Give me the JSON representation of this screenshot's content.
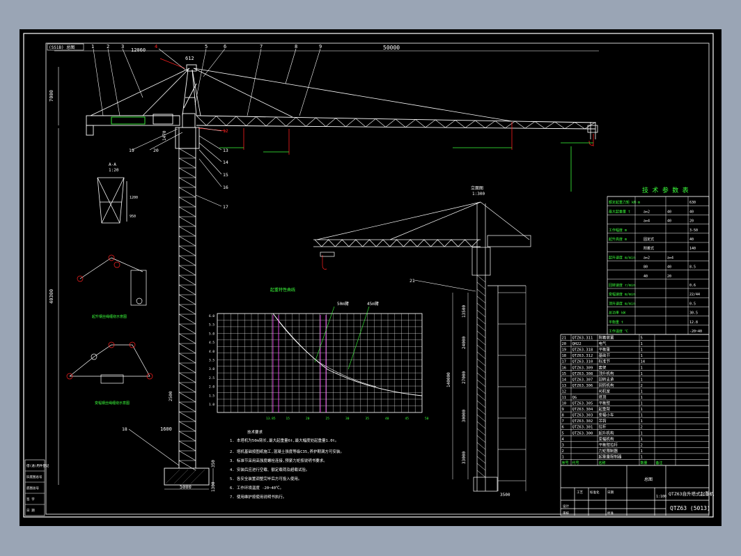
{
  "drawing": {
    "title_code": "QTZ63 (5013)",
    "title_name": "QTZ63自升塔式起重机",
    "scale_label": "1:100",
    "sheet_label": "总图",
    "top_tab": "(SS1B) 总图",
    "colors": {
      "background": "#000000",
      "line": "#ffffff",
      "green": "#3cff3c",
      "red": "#ff2020",
      "magenta": "#ff40ff",
      "yellow": "#ffff40"
    }
  },
  "dims": {
    "jib_length": "50000",
    "top_height": "7000",
    "counter_jib": "12060",
    "small_a": "612",
    "tower_height": "40300",
    "foundation_width": "5000",
    "foundation_h1": "1300",
    "foundation_h2": "350",
    "section_2500": "2500",
    "section_1600": "1600",
    "cab_1470": "1470",
    "right_dim_13500": "13500",
    "right_dim_24000": "24000",
    "right_dim_27000": "27000",
    "right_dim_30000": "30000",
    "right_dim_33000": "33000",
    "right_total": "140000",
    "right_base": "3500",
    "detail_a_1200": "1200",
    "detail_a_950": "950"
  },
  "callouts": {
    "top": [
      "1",
      "2",
      "3",
      "4",
      "5",
      "6",
      "7",
      "8",
      "9"
    ],
    "side": [
      "10",
      "11",
      "12",
      "13",
      "14",
      "15",
      "16",
      "17",
      "18",
      "19",
      "20",
      "21"
    ]
  },
  "labels": {
    "detail_a_title": "A-A",
    "detail_a_scale": "1:20",
    "elevation_title": "立面图",
    "elevation_scale": "1:300",
    "hoist_diagram": "起升钢丝绳缠绕示意图",
    "trolley_diagram": "变幅钢丝绳缠绕示意图",
    "load_chart_title": "起重特性曲线",
    "curve_50": "50m臂",
    "curve_45": "45m臂",
    "notes_title": "技术要求"
  },
  "load_chart": {
    "y_ticks": [
      "6.0",
      "5.5",
      "5.0",
      "4.5",
      "4.0",
      "3.5",
      "3.0",
      "2.5",
      "2.0",
      "1.5",
      "1.0"
    ],
    "x_ticks": [
      "13.85",
      "15",
      "20",
      "25",
      "30",
      "35",
      "40",
      "45",
      "50"
    ]
  },
  "notes": [
    "1. 本塔机为50m臂长,最大起重量6t,最大幅度处起重量1.0t。",
    "2. 塔机基础按图纸施工,混凝土强度等级C35,养护期满方可安装。",
    "3. 标准节采用高强度螺栓连接,预紧力矩按说明书要求。",
    "4. 安装后应进行空载、额定载荷及超载试验。",
    "5. 各安全装置调整完毕后方可投入使用。",
    "6. 工作环境温度 -20~40℃。",
    "7. 使用维护按使用说明书执行。"
  ],
  "spec_table": {
    "title": "技 术 参 数 表",
    "rows": [
      [
        "额定起重力矩 kN·m",
        "",
        "",
        "",
        "630"
      ],
      [
        "最大起重量 t",
        "",
        "a=2",
        "40",
        "40"
      ],
      [
        "",
        "",
        "a=4",
        "40",
        "20"
      ],
      [
        "工作幅度 m",
        "",
        "",
        "",
        "3-50"
      ],
      [
        "起升高度 m",
        "",
        "固定式",
        "",
        "40"
      ],
      [
        "",
        "",
        "附着式",
        "",
        "140"
      ],
      [
        "起升速度 m/min",
        "",
        "a=2",
        "a=4",
        ""
      ],
      [
        "",
        "",
        "80",
        "40",
        "8.5"
      ],
      [
        "",
        "",
        "40",
        "20",
        ""
      ],
      [
        "回转速度 r/min",
        "",
        "",
        "",
        "0.6"
      ],
      [
        "变幅速度 m/min",
        "",
        "",
        "",
        "22/44"
      ],
      [
        "顶升速度 m/min",
        "",
        "",
        "",
        "0.5"
      ],
      [
        "总功率 kW",
        "",
        "",
        "",
        "30.5"
      ],
      [
        "平衡重 t",
        "",
        "",
        "",
        "12.8"
      ],
      [
        "工作温度 ℃",
        "",
        "",
        "",
        "-20~40"
      ]
    ]
  },
  "parts_table": {
    "rows": [
      [
        "21",
        "QTZ63.311",
        "附着装置",
        "5",
        ""
      ],
      [
        "20",
        "QH22",
        "电气",
        "1",
        ""
      ],
      [
        "19",
        "QTZ63.318",
        "平衡重",
        "1",
        ""
      ],
      [
        "18",
        "QTZ63.312",
        "基础节",
        "1",
        ""
      ],
      [
        "17",
        "QTZ63.310",
        "标准节",
        "14",
        ""
      ],
      [
        "16",
        "QTZ63.309",
        "套架",
        "1",
        ""
      ],
      [
        "15",
        "QTZ63.308",
        "顶升机构",
        "1",
        ""
      ],
      [
        "14",
        "QTZ63.307",
        "回转支承",
        "1",
        ""
      ],
      [
        "13",
        "QTZ63.306",
        "回转机构",
        "2",
        ""
      ],
      [
        "12",
        "",
        "司机室",
        "1",
        ""
      ],
      [
        "11",
        "QG",
        "塔顶",
        "1",
        ""
      ],
      [
        "10",
        "QTZ63.305",
        "平衡臂",
        "1",
        ""
      ],
      [
        "9",
        "QTZ63.304",
        "起重臂",
        "1",
        ""
      ],
      [
        "8",
        "QTZ63.303",
        "变幅小车",
        "1",
        ""
      ],
      [
        "7",
        "QTZ63.302",
        "吊钩",
        "1",
        ""
      ],
      [
        "6",
        "QTZ63.301",
        "拉杆",
        "2",
        ""
      ],
      [
        "5",
        "QTZ63.300",
        "起升机构",
        "1",
        ""
      ],
      [
        "4",
        "",
        "变幅机构",
        "1",
        ""
      ],
      [
        "3",
        "",
        "平衡臂拉杆",
        "2",
        ""
      ],
      [
        "2",
        "",
        "力矩限制器",
        "1",
        ""
      ],
      [
        "1",
        "",
        "起重量限制器",
        "1",
        ""
      ]
    ],
    "header": [
      "序号",
      "代号",
      "名称",
      "数量",
      "备注"
    ]
  },
  "left_margin": [
    "借(通)用件登记",
    "旧底图总号",
    "底图总号",
    "签 字",
    "日 期"
  ],
  "title_block": {
    "designer": "设计",
    "checker": "审核",
    "approver": "批准",
    "process": "工艺",
    "standard": "标准化",
    "date": "日期"
  }
}
